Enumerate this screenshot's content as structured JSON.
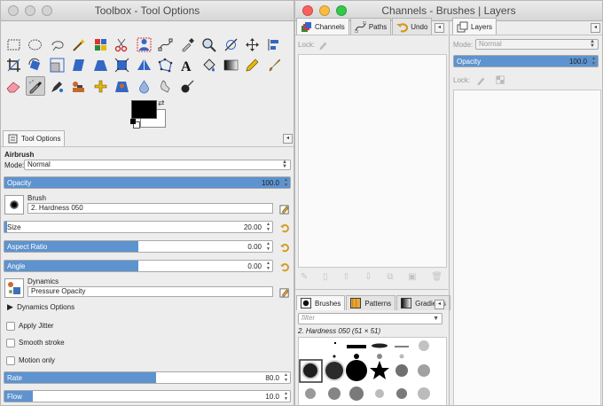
{
  "toolbox": {
    "title": "Toolbox - Tool Options",
    "tools": [
      "rect-select-icon",
      "ellipse-select-icon",
      "lasso-icon",
      "fuzzy-select-icon",
      "select-by-color-icon",
      "scissors-select-icon",
      "foreground-select-icon",
      "paths-icon",
      "color-picker-icon",
      "zoom-icon",
      "measure-icon",
      "move-icon",
      "align-icon",
      "crop-icon",
      "rotate-icon",
      "scale-icon",
      "shear-icon",
      "perspective-icon",
      "unified-transform-icon",
      "flip-icon",
      "cage-icon",
      "text-icon",
      "bucket-fill-icon",
      "blend-icon",
      "pencil-icon",
      "paintbrush-icon",
      "eraser-icon",
      "airbrush-icon",
      "ink-icon",
      "clone-icon",
      "heal-icon",
      "perspective-clone-icon",
      "blur-icon",
      "smudge-icon",
      "dodge-burn-icon"
    ],
    "colors": {
      "foreground": "#000000",
      "background": "#ffffff",
      "accent": "#5d93cf"
    },
    "tool_options_tab": "Tool Options",
    "section_title": "Airbrush",
    "mode_label": "Mode:",
    "mode_value": "Normal",
    "opacity": {
      "label": "Opacity",
      "value": "100.0",
      "fraction": 1.0
    },
    "brush": {
      "label": "Brush",
      "value": "2. Hardness 050"
    },
    "size": {
      "label": "Size",
      "value": "20.00",
      "fraction": 0.01
    },
    "aspect_ratio": {
      "label": "Aspect Ratio",
      "value": "0.00",
      "fraction": 0.5
    },
    "angle": {
      "label": "Angle",
      "value": "0.00",
      "fraction": 0.5
    },
    "dynamics": {
      "label": "Dynamics",
      "value": "Pressure Opacity"
    },
    "dynamics_options": "Dynamics Options",
    "apply_jitter": "Apply Jitter",
    "smooth_stroke": "Smooth stroke",
    "motion_only": "Motion only",
    "rate": {
      "label": "Rate",
      "value": "80.0",
      "fraction": 0.53
    },
    "flow": {
      "label": "Flow",
      "value": "10.0",
      "fraction": 0.1
    }
  },
  "channels": {
    "title": "Channels - Brushes | Layers",
    "tabs": [
      "Channels",
      "Paths",
      "Undo"
    ],
    "lock_label": "Lock:",
    "brush_tabs": [
      "Brushes",
      "Patterns",
      "Gradients"
    ],
    "filter_placeholder": "filter",
    "brush_name": "2. Hardness 050 (51 × 51)"
  },
  "layers": {
    "tab": "Layers",
    "mode_label": "Mode:",
    "mode_value": "Normal",
    "opacity_label": "Opacity",
    "opacity_value": "100.0",
    "lock_label": "Lock:"
  }
}
